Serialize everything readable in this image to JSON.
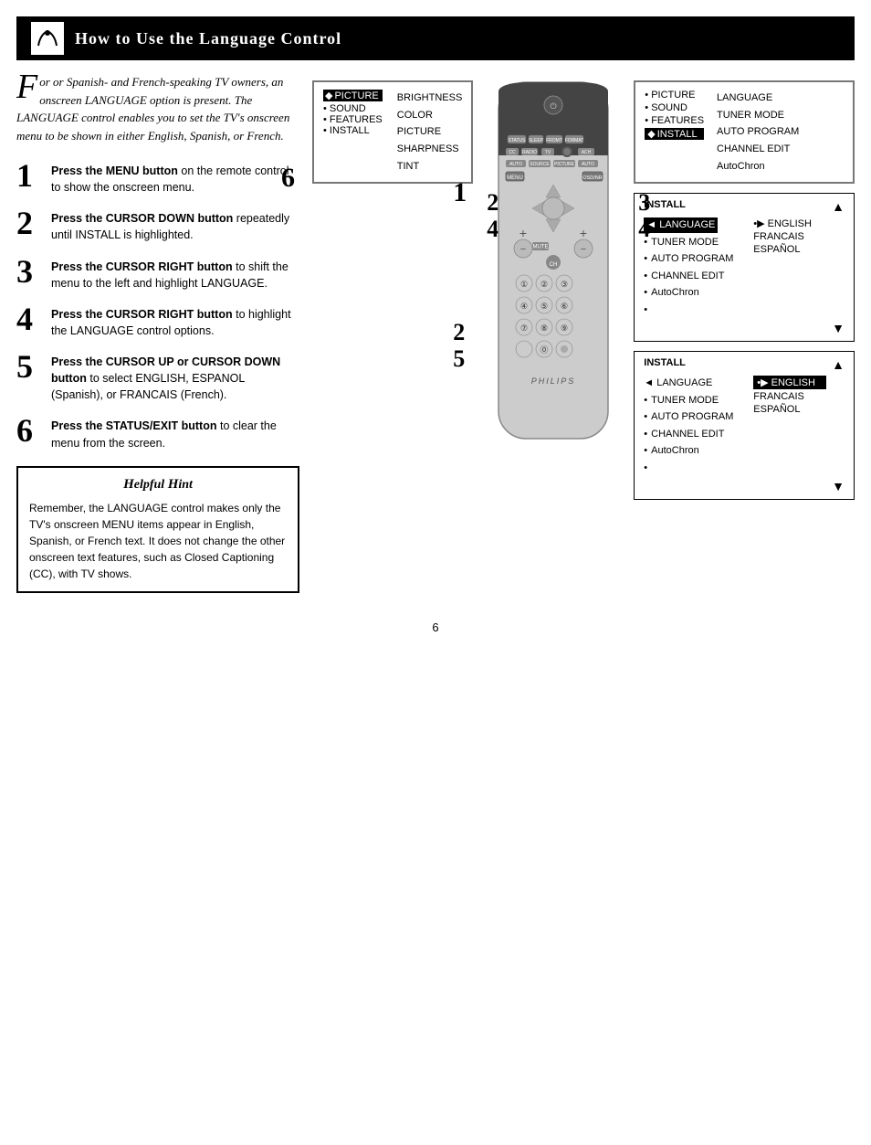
{
  "header": {
    "title": "How to Use the Language Control",
    "icon": "✎"
  },
  "intro": {
    "drop_cap": "F",
    "text": "or or Spanish- and French-speaking TV owners, an onscreen LANGUAGE option is present.  The LANGUAGE control enables you to set the TV's onscreen menu to be shown in either English, Spanish, or French."
  },
  "steps": [
    {
      "number": "1",
      "text": "Press the MENU button on the remote control to show the onscreen menu."
    },
    {
      "number": "2",
      "text": "Press the CURSOR DOWN button repeatedly until INSTALL is highlighted."
    },
    {
      "number": "3",
      "text": "Press the CURSOR RIGHT button to shift the menu to the left and highlight LANGUAGE."
    },
    {
      "number": "4",
      "text": "Press the CURSOR RIGHT button to highlight the LANGUAGE control options."
    },
    {
      "number": "5",
      "text": "Press the CURSOR UP or CURSOR DOWN button to select ENGLISH, ESPANOL (Spanish), or FRANCAIS (French)."
    },
    {
      "number": "6",
      "text": "Press the STATUS/EXIT button to clear the menu from the screen."
    }
  ],
  "hint": {
    "title": "Helpful Hint",
    "text": "Remember, the LANGUAGE control makes only the TV's onscreen MENU items appear in English, Spanish, or French text.  It does not change the other onscreen text features, such as Closed Captioning (CC), with TV shows."
  },
  "menu1": {
    "left_items": [
      "◆• PICTURE",
      "• SOUND",
      "• FEATURES",
      "• INSTALL"
    ],
    "right_items": [
      "BRIGHTNESS",
      "COLOR",
      "PICTURE",
      "SHARPNESS",
      "TINT"
    ]
  },
  "menu2": {
    "left_items": [
      "• PICTURE",
      "• SOUND",
      "• FEATURES",
      "◆• INSTALL"
    ],
    "right_items": [
      "LANGUAGE",
      "TUNER MODE",
      "AUTO PROGRAM",
      "CHANNEL EDIT",
      "AutoChron"
    ]
  },
  "menu3": {
    "title": "INSTALL",
    "left_items": [
      "◄ LANGUAGE",
      "• TUNER MODE",
      "• AUTO PROGRAM",
      "• CHANNEL EDIT",
      "• AutoChron",
      "•"
    ],
    "right_items": [
      "•▶ ENGLISH",
      "FRANCAIS",
      "ESPAÑOL"
    ],
    "highlighted_left": "◄ LANGUAGE",
    "arrow_up": "▲",
    "arrow_down": "▼"
  },
  "menu4": {
    "title": "INSTALL",
    "left_items": [
      "◄ LANGUAGE",
      "• TUNER MODE",
      "• AUTO PROGRAM",
      "• CHANNEL EDIT",
      "• AutoChron",
      "•"
    ],
    "right_items": [
      "•▶ ENGLISH",
      "FRANCAIS",
      "ESPAÑOL"
    ],
    "highlighted_right": "•▶ ENGLISH",
    "arrow_up": "▲",
    "arrow_down": "▼"
  },
  "page_number": "6",
  "step_badges": {
    "badge_6": "6",
    "badge_24_top": "2",
    "badge_24_bot": "4",
    "badge_1": "1",
    "badge_34_top": "3",
    "badge_34_bot": "4",
    "badge_25_top": "2",
    "badge_25_bot": "5"
  },
  "philips_label": "PHILIPS"
}
